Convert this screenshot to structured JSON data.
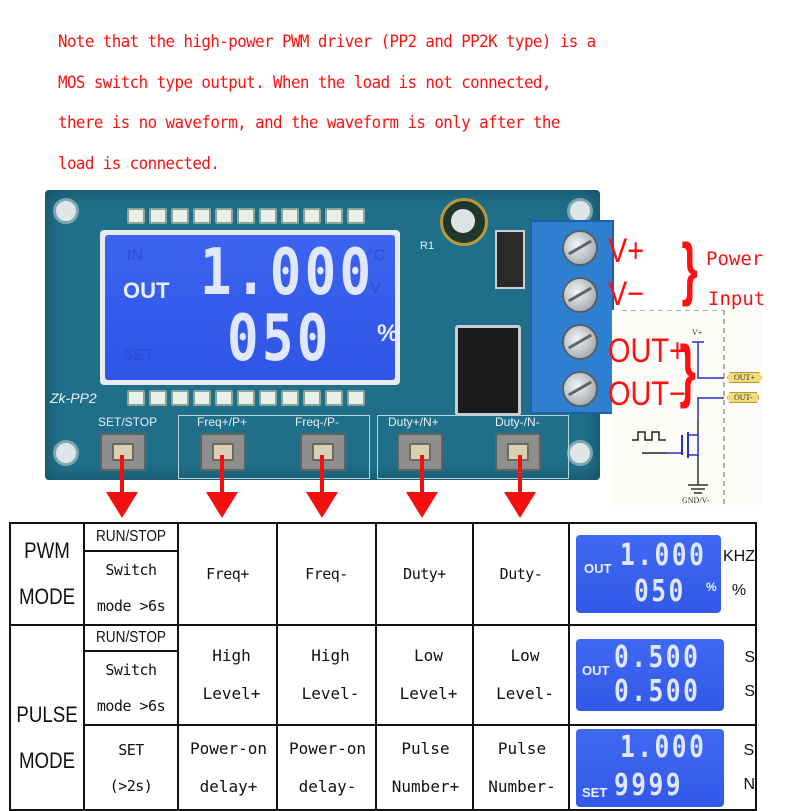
{
  "note": {
    "lines": [
      "Note that the high-power PWM driver (PP2 and PP2K type) is a",
      "MOS switch type output. When the load is not connected,",
      "there is no waveform, and the waveform is only after the",
      "load is connected."
    ],
    "color": "#ff1010"
  },
  "board": {
    "model": "Zk-PP2",
    "lcd": {
      "ghost_labels": [
        "IN",
        "SET",
        "°C",
        "V"
      ],
      "label": "OUT",
      "line1": "1.000",
      "line2": "050",
      "unit": "%"
    },
    "buttons": [
      "SET/STOP",
      "Freq+/P+",
      "Freq-/P-",
      "Duty+/N+",
      "Duty-/N-"
    ],
    "component_label": "R1"
  },
  "terminals": {
    "v_plus": "V+",
    "v_minus": "V−",
    "power_label_1": "Power",
    "power_label_2": "Input",
    "out_plus": "OUT+",
    "out_minus": "OUT−"
  },
  "schematic": {
    "vplus": "V+",
    "out_plus_tag": "OUT+",
    "out_minus_tag": "OUT-",
    "gnd": "GND/V-"
  },
  "table": {
    "pwm": {
      "mode_line1": "PWM",
      "mode_line2": "MODE",
      "btn1_top": "RUN/STOP",
      "btn1_l1": "Switch",
      "btn1_l2": "mode >6s",
      "btn2": "Freq+",
      "btn3": "Freq-",
      "btn4": "Duty+",
      "btn5": "Duty-",
      "lcd": {
        "label": "OUT",
        "line1": "1.000",
        "line2": "050",
        "inner_unit": "%"
      },
      "unit1": "KHZ",
      "unit2": "%"
    },
    "pulse": {
      "mode_line1": "PULSE",
      "mode_line2": "MODE",
      "row1": {
        "btn1_top": "RUN/STOP",
        "btn1_l1": "Switch",
        "btn1_l2": "mode >6s",
        "btn2_l1": "High",
        "btn2_l2": "Level+",
        "btn3_l1": "High",
        "btn3_l2": "Level-",
        "btn4_l1": "Low",
        "btn4_l2": "Level+",
        "btn5_l1": "Low",
        "btn5_l2": "Level-",
        "lcd": {
          "label": "OUT",
          "line1": "0.500",
          "line2": "0.500"
        },
        "unit1": "S",
        "unit2": "S"
      },
      "row2": {
        "btn1_l1": "SET",
        "btn1_l2": "(>2s)",
        "btn2_l1": "Power-on",
        "btn2_l2": "delay+",
        "btn3_l1": "Power-on",
        "btn3_l2": "delay-",
        "btn4_l1": "Pulse",
        "btn4_l2": "Number+",
        "btn5_l1": "Pulse",
        "btn5_l2": "Number-",
        "lcd": {
          "label": "SET",
          "line1": "1.000",
          "line2": "9999"
        },
        "unit1": "S",
        "unit2": "N"
      }
    }
  }
}
